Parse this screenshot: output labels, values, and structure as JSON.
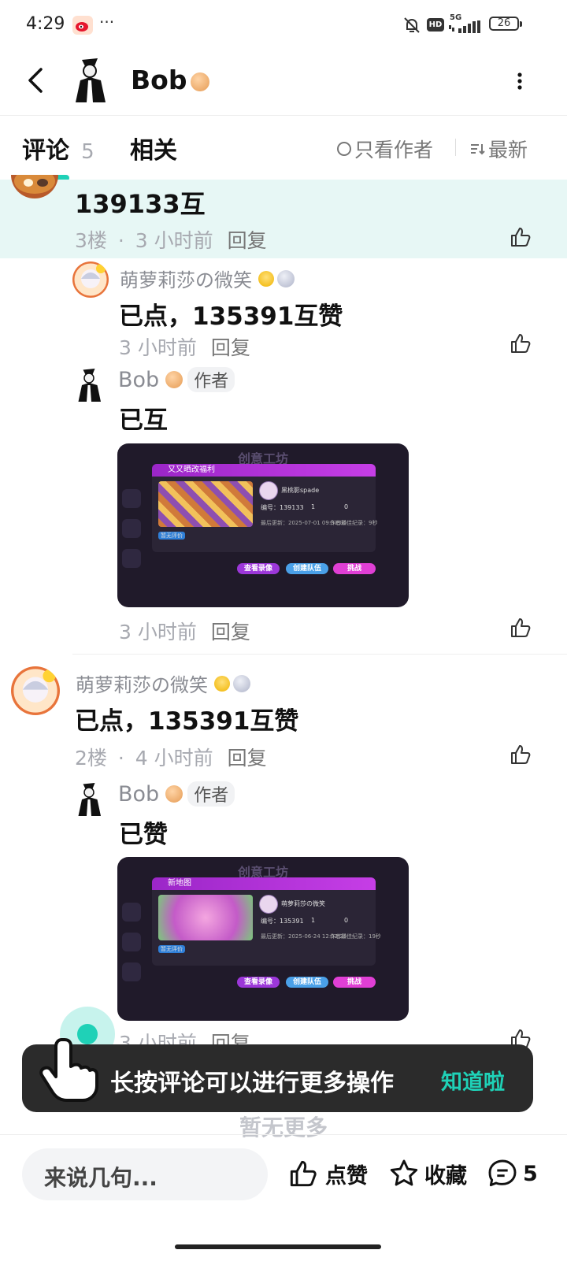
{
  "status_bar": {
    "time": "4:29",
    "dots": "···",
    "network": "5G",
    "hd": "HD",
    "battery": "26"
  },
  "header": {
    "author_name": "Bob"
  },
  "tabs": {
    "comments_label": "评论",
    "comments_count": "5",
    "related_label": "相关",
    "only_author_label": "只看作者",
    "latest_label": "最新"
  },
  "comments": [
    {
      "text": "139133互",
      "floor": "3楼",
      "sep": "·",
      "time": "3 小时前",
      "reply_label": "回复",
      "replies": [
        {
          "user": "萌萝莉莎の微笑",
          "text": "已点，135391互赞",
          "time": "3 小时前",
          "reply_label": "回复"
        },
        {
          "user": "Bob",
          "author_tag": "作者",
          "text": "已互",
          "time": "3 小时前",
          "reply_label": "回复",
          "image": {
            "header": "创意工坊",
            "bar_title": "又又晒改福利",
            "player": "黑桃影spade",
            "id_line": "编号：139133",
            "likes": "1",
            "plays": "0",
            "chip": "暂无评价",
            "date": "最后更新：2025-07-01 09:33:05",
            "stat": "作者最佳纪录：9秒",
            "btn_record": "查看录像",
            "btn_team": "创建队伍",
            "btn_challenge": "挑战"
          }
        }
      ]
    },
    {
      "user": "萌萝莉莎の微笑",
      "text": "已点，135391互赞",
      "floor": "2楼",
      "sep": "·",
      "time": "4 小时前",
      "reply_label": "回复",
      "replies": [
        {
          "user": "Bob",
          "author_tag": "作者",
          "text": "已赞",
          "time": "3 小时前",
          "reply_label": "回复",
          "image": {
            "header": "创意工坊",
            "bar_title": "新地图",
            "player": "萌萝莉莎の微笑",
            "id_line": "编号：135391",
            "likes": "1",
            "plays": "0",
            "chip": "暂无评价",
            "date": "最后更新：2025-06-24 12:32:25",
            "stat": "作者最佳纪录：19秒",
            "btn_record": "查看录像",
            "btn_team": "创建队伍",
            "btn_challenge": "挑战"
          }
        }
      ]
    }
  ],
  "toast": {
    "message": "长按评论可以进行更多操作",
    "action": "知道啦"
  },
  "footer_hint": "暂无更多",
  "bottom_bar": {
    "input_placeholder": "来说几句...",
    "like_label": "点赞",
    "fav_label": "收藏",
    "comment_count": "5"
  },
  "colors": {
    "highlight_bg": "#e7f7f5",
    "accent": "#1fd1b7",
    "toast_bg": "#2b2b2b",
    "muted": "#a7a9b0"
  }
}
